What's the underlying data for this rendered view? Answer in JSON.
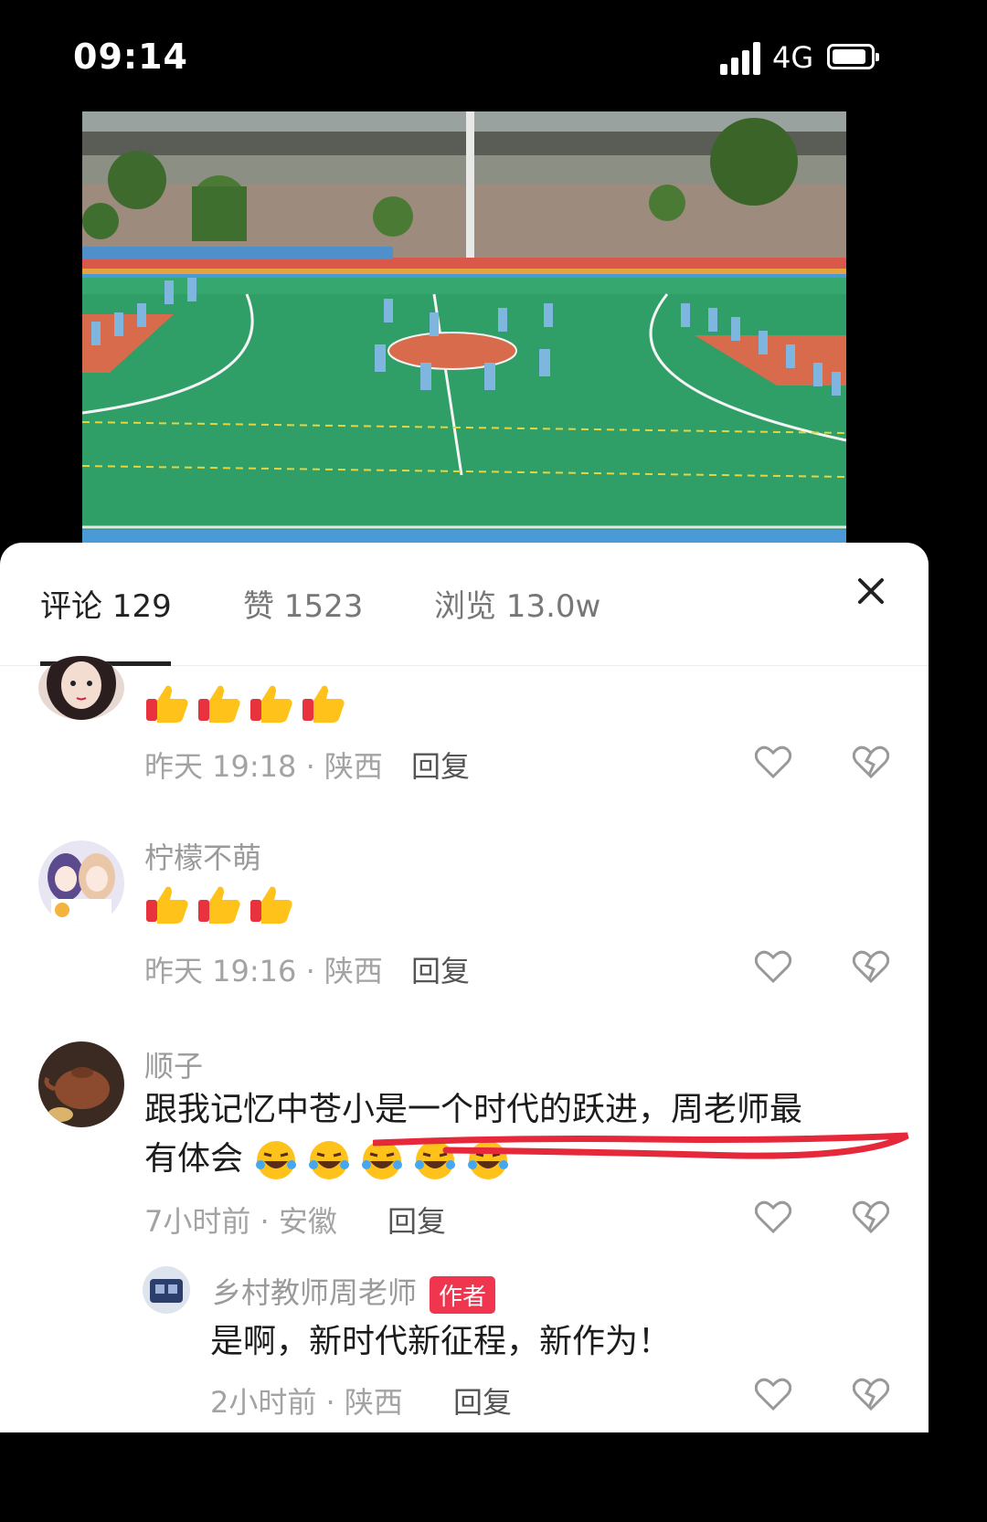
{
  "status_bar": {
    "time": "09:14",
    "network": "4G"
  },
  "video": {
    "description_icon": "video-frame"
  },
  "tabs": {
    "comments": "评论 129",
    "likes": "赞 1523",
    "views": "浏览 13.0w"
  },
  "comments": [
    {
      "name": "",
      "text_emoji": "thumbs-up x4",
      "meta": "昨天 19:18 · 陕西",
      "reply": "回复"
    },
    {
      "name": "柠檬不萌",
      "text_emoji": "thumbs-up x3",
      "meta": "昨天 19:16 · 陕西",
      "reply": "回复"
    },
    {
      "name": "顺子",
      "text_line1": "跟我记忆中苍小是一个时代的跃进，周老师最",
      "text_line2": "有体会",
      "meta": "7小时前 · 安徽",
      "reply": "回复"
    },
    {
      "name": "乡村教师周老师",
      "badge": "作者",
      "text": "是啊，新时代新征程，新作为！",
      "meta": "2小时前 · 陕西",
      "reply": "回复"
    }
  ],
  "colors": {
    "accent_red": "#f0354f",
    "thumb_yellow": "#ffc21a",
    "sleeve_red": "#e8323e"
  }
}
